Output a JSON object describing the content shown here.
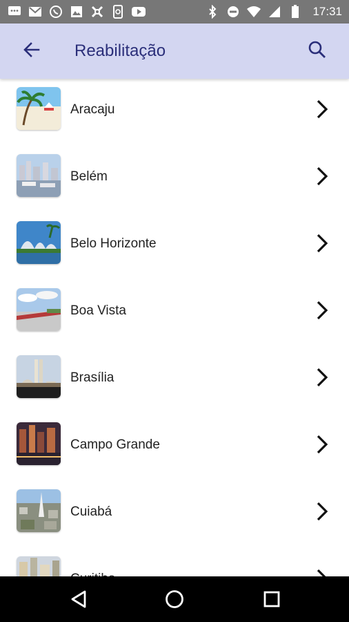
{
  "status_bar": {
    "time": "17:31",
    "left_icons": [
      "chat-icon",
      "gmail-icon",
      "whatsapp-icon",
      "image-icon",
      "crossed-tools-icon",
      "phone-sync-icon",
      "youtube-icon"
    ],
    "right_icons": [
      "bluetooth-icon",
      "do-not-disturb-icon",
      "wifi-icon",
      "signal-icon",
      "battery-icon"
    ]
  },
  "app_bar": {
    "title": "Reabilitação",
    "back_icon": "arrow-back-icon",
    "search_icon": "search-icon",
    "background": "#d3d6f1",
    "title_color": "#2b2f7a"
  },
  "cities": [
    {
      "label": "Aracaju",
      "thumb": "beach"
    },
    {
      "label": "Belém",
      "thumb": "harbor"
    },
    {
      "label": "Belo Horizonte",
      "thumb": "church-lake"
    },
    {
      "label": "Boa Vista",
      "thumb": "riverfront"
    },
    {
      "label": "Brasília",
      "thumb": "congress"
    },
    {
      "label": "Campo Grande",
      "thumb": "night-city"
    },
    {
      "label": "Cuiabá",
      "thumb": "aerial-city"
    },
    {
      "label": "Curitiba",
      "thumb": "buildings"
    }
  ],
  "nav_bar": {
    "icons": [
      "back-triangle-icon",
      "home-circle-icon",
      "recents-square-icon"
    ]
  }
}
